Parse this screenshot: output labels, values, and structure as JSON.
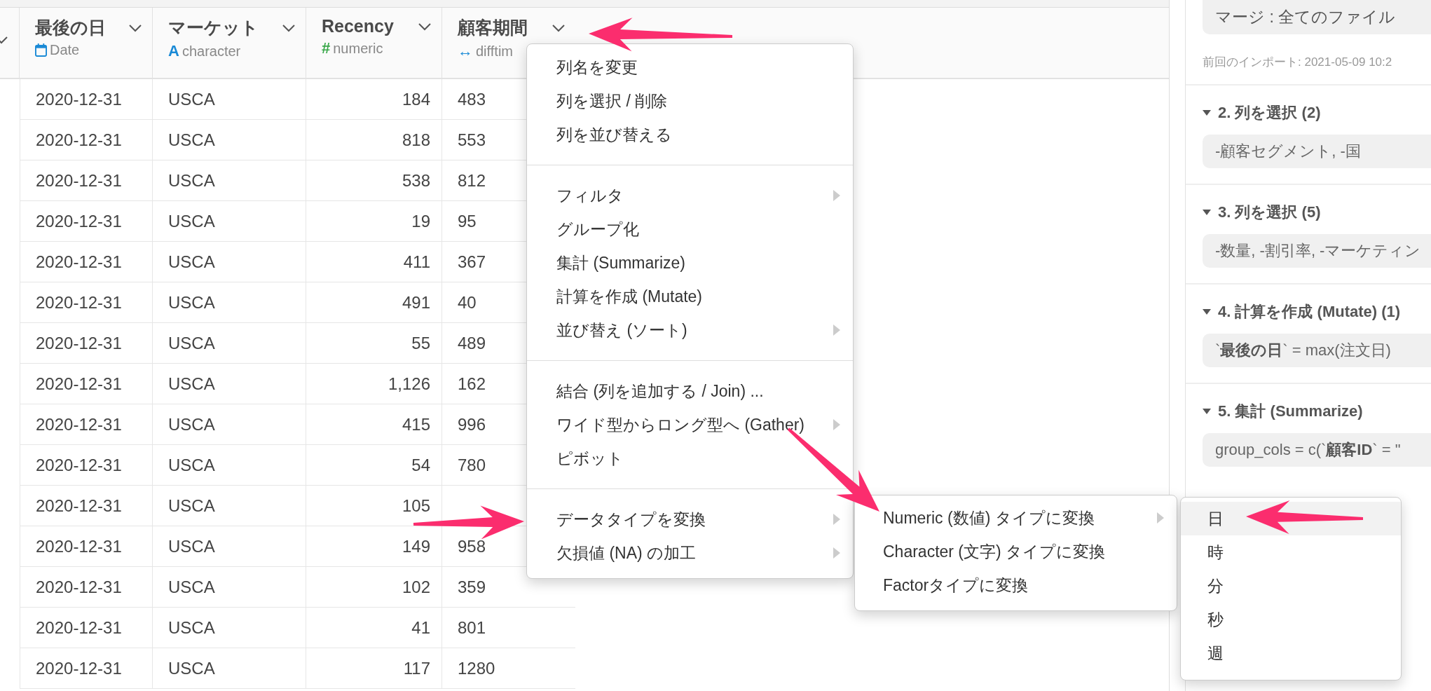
{
  "table": {
    "columns": [
      {
        "name": "最後の日",
        "type": "Date",
        "kind": "date"
      },
      {
        "name": "マーケット",
        "type": "character",
        "kind": "character",
        "type_glyph": "A"
      },
      {
        "name": "Recency",
        "type": "numeric",
        "kind": "numeric",
        "type_glyph": "#"
      },
      {
        "name": "顧客期間",
        "type": "difftim",
        "kind": "difftime",
        "type_glyph": "↔"
      }
    ],
    "rows": [
      {
        "date": "2020-12-31",
        "market": "USCA",
        "recency": "184",
        "period": "483"
      },
      {
        "date": "2020-12-31",
        "market": "USCA",
        "recency": "818",
        "period": "553"
      },
      {
        "date": "2020-12-31",
        "market": "USCA",
        "recency": "538",
        "period": "812"
      },
      {
        "date": "2020-12-31",
        "market": "USCA",
        "recency": "19",
        "period": "95"
      },
      {
        "date": "2020-12-31",
        "market": "USCA",
        "recency": "411",
        "period": "367"
      },
      {
        "date": "2020-12-31",
        "market": "USCA",
        "recency": "491",
        "period": "40"
      },
      {
        "date": "2020-12-31",
        "market": "USCA",
        "recency": "55",
        "period": "489"
      },
      {
        "date": "2020-12-31",
        "market": "USCA",
        "recency": "1,126",
        "period": "162"
      },
      {
        "date": "2020-12-31",
        "market": "USCA",
        "recency": "415",
        "period": "996"
      },
      {
        "date": "2020-12-31",
        "market": "USCA",
        "recency": "54",
        "period": "780"
      },
      {
        "date": "2020-12-31",
        "market": "USCA",
        "recency": "105"
      },
      {
        "date": "2020-12-31",
        "market": "USCA",
        "recency": "149",
        "period": "958"
      },
      {
        "date": "2020-12-31",
        "market": "USCA",
        "recency": "102",
        "period": "359"
      },
      {
        "date": "2020-12-31",
        "market": "USCA",
        "recency": "41",
        "period": "801"
      },
      {
        "date": "2020-12-31",
        "market": "USCA",
        "recency": "117",
        "period": "1280"
      }
    ]
  },
  "context_menu": {
    "sections": [
      [
        {
          "label": "列名を変更",
          "has_submenu": false
        },
        {
          "label": "列を選択 / 削除",
          "has_submenu": false
        },
        {
          "label": "列を並び替える",
          "has_submenu": false
        }
      ],
      [
        {
          "label": "フィルタ",
          "has_submenu": true
        },
        {
          "label": "グループ化",
          "has_submenu": false
        },
        {
          "label": "集計 (Summarize)",
          "has_submenu": false
        },
        {
          "label": "計算を作成 (Mutate)",
          "has_submenu": false
        },
        {
          "label": "並び替え (ソート)",
          "has_submenu": true
        }
      ],
      [
        {
          "label": "結合 (列を追加する / Join) ...",
          "has_submenu": false
        },
        {
          "label": "ワイド型からロング型へ (Gather)",
          "has_submenu": true
        },
        {
          "label": "ピボット",
          "has_submenu": false
        }
      ],
      [
        {
          "label": "データタイプを変換",
          "has_submenu": true
        },
        {
          "label": "欠損値 (NA) の加工",
          "has_submenu": true
        }
      ]
    ]
  },
  "type_submenu": {
    "items": [
      {
        "label": "Numeric (数値) タイプに変換",
        "has_submenu": true
      },
      {
        "label": "Character (文字) タイプに変換",
        "has_submenu": false
      },
      {
        "label": "Factorタイプに変換",
        "has_submenu": false
      }
    ]
  },
  "unit_submenu": {
    "items": [
      {
        "label": "日",
        "selected": true
      },
      {
        "label": "時",
        "selected": false
      },
      {
        "label": "分",
        "selected": false
      },
      {
        "label": "秒",
        "selected": false
      },
      {
        "label": "週",
        "selected": false
      }
    ]
  },
  "steps_panel": {
    "source": "マージ : 全てのファイル",
    "last_import": "前回のインポート: 2021-05-09 10:2",
    "steps": [
      {
        "title": "2. 列を選択 (2)",
        "expanded": true,
        "body": "-顧客セグメント, -国"
      },
      {
        "title": "3. 列を選択 (5)",
        "expanded": true,
        "body": "-数量, -割引率, -マーケティン"
      },
      {
        "title": "4. 計算を作成 (Mutate) (1)",
        "expanded": true,
        "body": "`**最後の日**` = max(注文日)"
      },
      {
        "title": "5. 集計 (Summarize)",
        "expanded": true,
        "body": "group_cols = c(`**顧客ID**` = \""
      }
    ]
  }
}
